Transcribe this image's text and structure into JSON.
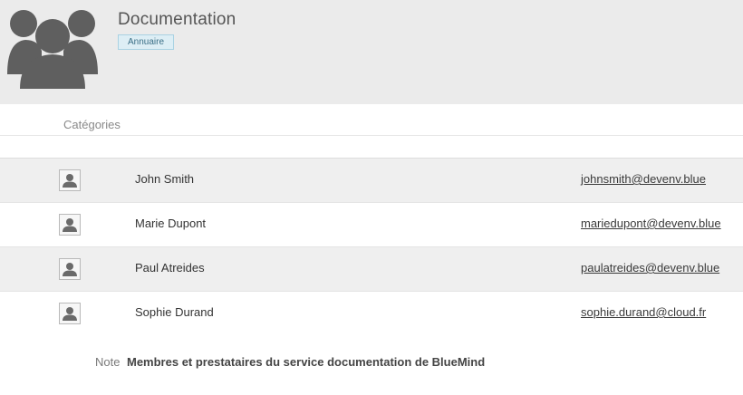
{
  "header": {
    "title": "Documentation",
    "badge": "Annuaire",
    "avatar_icon": "group-icon"
  },
  "categories": {
    "label": "Catégories"
  },
  "members": [
    {
      "name": "John Smith",
      "email": "johnsmith@devenv.blue",
      "avatar_icon": "user-icon"
    },
    {
      "name": "Marie Dupont",
      "email": "mariedupont@devenv.blue",
      "avatar_icon": "user-icon"
    },
    {
      "name": "Paul Atreides",
      "email": "paulatreides@devenv.blue",
      "avatar_icon": "user-icon"
    },
    {
      "name": "Sophie Durand",
      "email": "sophie.durand@cloud.fr",
      "avatar_icon": "user-icon"
    }
  ],
  "note": {
    "label": "Note",
    "text": "Membres et prestataires du service documentation de BlueMind"
  },
  "colors": {
    "header_bg": "#ebebeb",
    "row_alt_bg": "#efefef",
    "badge_bg": "#ddeef5",
    "icon": "#5f5f5f"
  }
}
